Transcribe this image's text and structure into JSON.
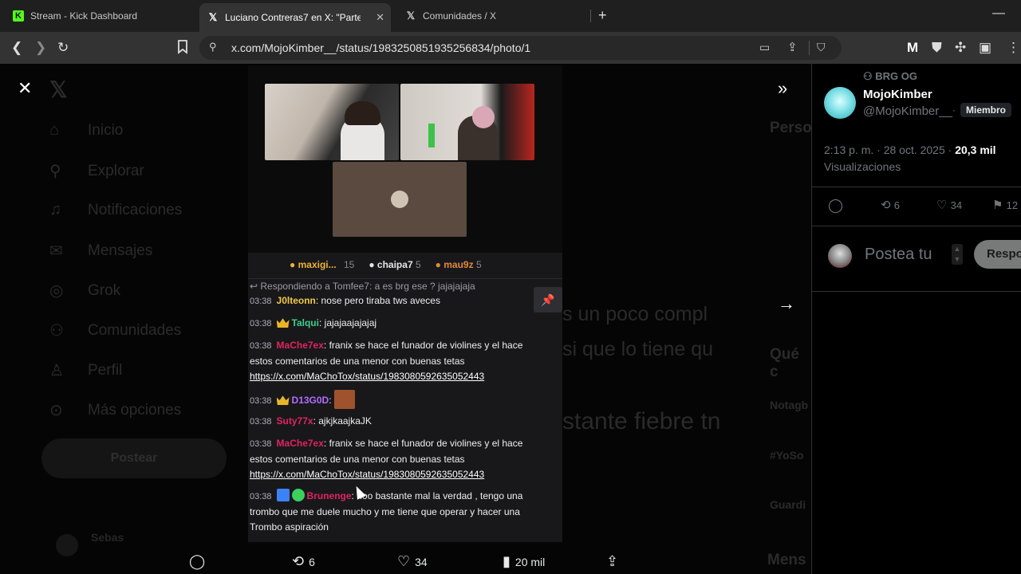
{
  "browser": {
    "tabs": [
      {
        "label": "Stream - Kick Dashboard",
        "favicon": "kick-icon"
      },
      {
        "label": "Luciano Contreras7 en X: \"Parte",
        "favicon": "x-icon"
      },
      {
        "label": "Comunidades / X",
        "favicon": "x-icon"
      }
    ],
    "url": "x.com/MojoKimber__/status/1983250851935256834/photo/1"
  },
  "sidebar": {
    "items": [
      {
        "label": "Inicio",
        "icon": "home-icon"
      },
      {
        "label": "Explorar",
        "icon": "search-icon"
      },
      {
        "label": "Notificaciones",
        "icon": "bell-icon"
      },
      {
        "label": "Mensajes",
        "icon": "mail-icon"
      },
      {
        "label": "Grok",
        "icon": "grok-icon"
      },
      {
        "label": "Comunidades",
        "icon": "people-icon"
      },
      {
        "label": "Perfil",
        "icon": "person-icon"
      },
      {
        "label": "Más opciones",
        "icon": "more-icon"
      }
    ],
    "post_button": "Postear",
    "profile_name": "Sebas"
  },
  "background_text": {
    "line1": "s un poco compl",
    "line2": "si que lo tiene qu",
    "line3": "stante fiebre tn",
    "right_header": "Perso",
    "right_que": "Qué c",
    "right_items": [
      "Notagb",
      "#YoSo",
      "Guardi"
    ],
    "mensajes": "Mens"
  },
  "stream": {
    "leaderboard": [
      {
        "name": "maxigi...",
        "count": "15",
        "color": "#f0b232"
      },
      {
        "name": "chaipa7",
        "count": "5",
        "color": "#e6e6e6"
      },
      {
        "name": "mau9z",
        "count": "5",
        "color": "#e08a3c"
      }
    ],
    "reply_note": "Respondiendo a Tomfee7: a es brg ese ? jajajajaja",
    "messages": [
      {
        "time": "03:38",
        "user": "J0lteonn",
        "user_color": "#f0c948",
        "text": "nose pero tiraba tws aveces"
      },
      {
        "time": "03:38",
        "user": "Talqui",
        "user_color": "#3ccf8e",
        "text": "jajajaajajajaj"
      },
      {
        "time": "03:38",
        "user": "MaChe7ex",
        "user_color": "#e0245e",
        "text": "franix se hace el funador de violines y el hace",
        "text2": "estos comentarios de una menor con buenas tetas",
        "link": "https://x.com/MaChoTox/status/1983080592635052443"
      },
      {
        "time": "03:38",
        "user": "D13G0D",
        "user_color": "#b36bff",
        "text": ""
      },
      {
        "time": "03:38",
        "user": "Suty77x",
        "user_color": "#e0245e",
        "text": "ajkjkaajkaJK"
      },
      {
        "time": "03:38",
        "user": "MaChe7ex",
        "user_color": "#e0245e",
        "text": "franix se hace el funador de violines y el hace",
        "text2": "estos comentarios de una menor con buenas tetas",
        "link": "https://x.com/MaChoTox/status/1983080592635052443"
      },
      {
        "time": "03:38",
        "user": "Brunenge",
        "user_color": "#e0245e",
        "text": "noo bastante mal la verdad , tengo una",
        "text2": "trombo que me duele mucho y me tiene que operar y hacer una",
        "text3": "Trombo aspiración"
      }
    ]
  },
  "tweet": {
    "community": "BRG OG",
    "name": "MojoKimber",
    "handle": "@MojoKimber__",
    "role": "Miembro",
    "time": "2:13 p. m. · 28 oct. 2025 ·",
    "views_count": "20,3 mil",
    "views_label": "Visualizaciones",
    "retweets": "6",
    "likes": "34",
    "bookmarks": "12",
    "reply_placeholder": "Postea tu",
    "reply_button": "Respo"
  },
  "bottom_bar": {
    "retweets": "6",
    "likes": "34",
    "views": "20 mil"
  }
}
